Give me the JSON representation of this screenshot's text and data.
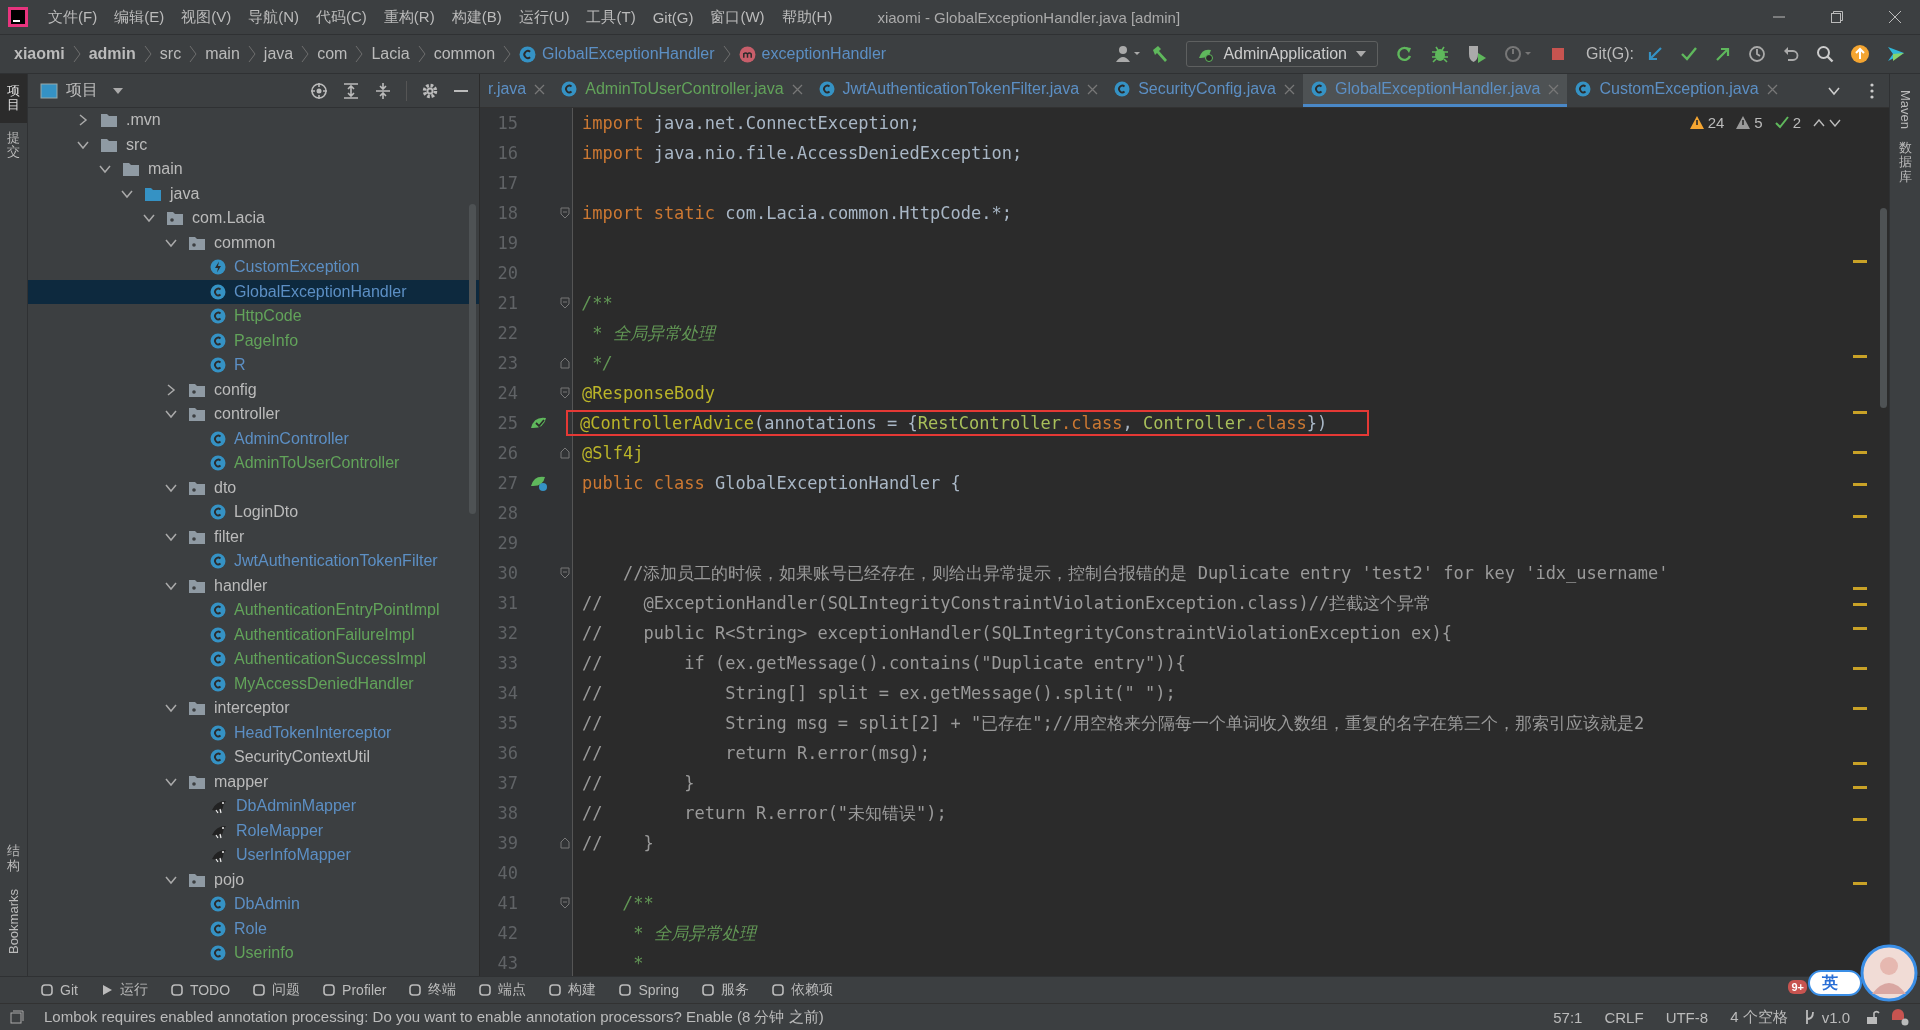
{
  "window": {
    "title": "xiaomi - GlobalExceptionHandler.java [admin]"
  },
  "menu": [
    "文件(F)",
    "编辑(E)",
    "视图(V)",
    "导航(N)",
    "代码(C)",
    "重构(R)",
    "构建(B)",
    "运行(U)",
    "工具(T)",
    "Git(G)",
    "窗口(W)",
    "帮助(H)"
  ],
  "breadcrumbs": [
    {
      "label": "xiaomi",
      "kind": "bold"
    },
    {
      "label": "admin",
      "kind": "bold"
    },
    {
      "label": "src",
      "kind": "plain"
    },
    {
      "label": "main",
      "kind": "plain"
    },
    {
      "label": "java",
      "kind": "plain"
    },
    {
      "label": "com",
      "kind": "plain"
    },
    {
      "label": "Lacia",
      "kind": "plain"
    },
    {
      "label": "common",
      "kind": "plain"
    },
    {
      "label": "GlobalExceptionHandler",
      "kind": "class"
    },
    {
      "label": "exceptionHandler",
      "kind": "method"
    }
  ],
  "toolbar": {
    "run_config": "AdminApplication",
    "git_label": "Git(G):"
  },
  "left_tool_strip": [
    {
      "label": "项目",
      "selected": true,
      "kind": "cjk"
    },
    {
      "label": "提交",
      "selected": false,
      "kind": "cjk"
    },
    {
      "label": "结构",
      "selected": false,
      "kind": "cjk"
    },
    {
      "label": "Bookmarks",
      "selected": false,
      "kind": "latin"
    }
  ],
  "project_panel": {
    "title": "项目"
  },
  "tree": {
    "items": [
      {
        "label": ".mvn",
        "kind": "folder",
        "expanded": false,
        "selected": false,
        "color": "#bbbbbb"
      },
      {
        "label": "src",
        "kind": "folder",
        "expanded": true,
        "selected": false,
        "color": "#bbbbbb",
        "children": [
          {
            "label": "main",
            "kind": "folder",
            "expanded": true,
            "selected": false,
            "color": "#bbbbbb",
            "children": [
              {
                "label": "java",
                "kind": "source",
                "expanded": true,
                "selected": false,
                "color": "#bbbbbb",
                "children": [
                  {
                    "label": "com.Lacia",
                    "kind": "package",
                    "expanded": true,
                    "selected": false,
                    "color": "#bbbbbb",
                    "children": [
                      {
                        "label": "common",
                        "kind": "package",
                        "expanded": true,
                        "selected": false,
                        "color": "#bbbbbb",
                        "children": [
                          {
                            "label": "CustomException",
                            "kind": "exception",
                            "selected": false,
                            "color": "#5c8fc4"
                          },
                          {
                            "label": "GlobalExceptionHandler",
                            "kind": "class",
                            "selected": true,
                            "color": "#5c8fc4"
                          },
                          {
                            "label": "HttpCode",
                            "kind": "class",
                            "selected": false,
                            "color": "#62a35a"
                          },
                          {
                            "label": "PageInfo",
                            "kind": "class",
                            "selected": false,
                            "color": "#62a35a"
                          },
                          {
                            "label": "R",
                            "kind": "class",
                            "selected": false,
                            "color": "#5c8fc4"
                          }
                        ]
                      },
                      {
                        "label": "config",
                        "kind": "package",
                        "expanded": false,
                        "selected": false,
                        "color": "#bbbbbb"
                      },
                      {
                        "label": "controller",
                        "kind": "package",
                        "expanded": true,
                        "selected": false,
                        "color": "#bbbbbb",
                        "children": [
                          {
                            "label": "AdminController",
                            "kind": "class",
                            "selected": false,
                            "color": "#5c8fc4"
                          },
                          {
                            "label": "AdminToUserController",
                            "kind": "class",
                            "selected": false,
                            "color": "#62a35a"
                          }
                        ]
                      },
                      {
                        "label": "dto",
                        "kind": "package",
                        "expanded": true,
                        "selected": false,
                        "color": "#bbbbbb",
                        "children": [
                          {
                            "label": "LoginDto",
                            "kind": "class",
                            "selected": false,
                            "color": "#bbbbbb"
                          }
                        ]
                      },
                      {
                        "label": "filter",
                        "kind": "package",
                        "expanded": true,
                        "selected": false,
                        "color": "#bbbbbb",
                        "children": [
                          {
                            "label": "JwtAuthenticationTokenFilter",
                            "kind": "class",
                            "selected": false,
                            "color": "#5c8fc4"
                          }
                        ]
                      },
                      {
                        "label": "handler",
                        "kind": "package",
                        "expanded": true,
                        "selected": false,
                        "color": "#bbbbbb",
                        "children": [
                          {
                            "label": "AuthenticationEntryPointImpl",
                            "kind": "class",
                            "selected": false,
                            "color": "#62a35a"
                          },
                          {
                            "label": "AuthenticationFailureImpl",
                            "kind": "class",
                            "selected": false,
                            "color": "#62a35a"
                          },
                          {
                            "label": "AuthenticationSuccessImpl",
                            "kind": "class",
                            "selected": false,
                            "color": "#62a35a"
                          },
                          {
                            "label": "MyAccessDeniedHandler",
                            "kind": "class",
                            "selected": false,
                            "color": "#62a35a"
                          }
                        ]
                      },
                      {
                        "label": "interceptor",
                        "kind": "package",
                        "expanded": true,
                        "selected": false,
                        "color": "#bbbbbb",
                        "children": [
                          {
                            "label": "HeadTokenInterceptor",
                            "kind": "class",
                            "selected": false,
                            "color": "#5c8fc4"
                          },
                          {
                            "label": "SecurityContextUtil",
                            "kind": "class",
                            "selected": false,
                            "color": "#bbbbbb"
                          }
                        ]
                      },
                      {
                        "label": "mapper",
                        "kind": "package",
                        "expanded": true,
                        "selected": false,
                        "color": "#bbbbbb",
                        "children": [
                          {
                            "label": "DbAdminMapper",
                            "kind": "mapper",
                            "selected": false,
                            "color": "#5c8fc4"
                          },
                          {
                            "label": "RoleMapper",
                            "kind": "mapper",
                            "selected": false,
                            "color": "#5c8fc4"
                          },
                          {
                            "label": "UserInfoMapper",
                            "kind": "mapper",
                            "selected": false,
                            "color": "#5c8fc4"
                          }
                        ]
                      },
                      {
                        "label": "pojo",
                        "kind": "package",
                        "expanded": true,
                        "selected": false,
                        "color": "#bbbbbb",
                        "children": [
                          {
                            "label": "DbAdmin",
                            "kind": "class",
                            "selected": false,
                            "color": "#5c8fc4"
                          },
                          {
                            "label": "Role",
                            "kind": "class",
                            "selected": false,
                            "color": "#5c8fc4"
                          },
                          {
                            "label": "Userinfo",
                            "kind": "class",
                            "selected": false,
                            "color": "#62a35a"
                          }
                        ]
                      }
                    ]
                  }
                ]
              }
            ]
          }
        ]
      }
    ]
  },
  "tabs": [
    {
      "label": "r.java",
      "kind": "clipped",
      "selected": false,
      "color": "#5c8fc4"
    },
    {
      "label": "AdminToUserController.java",
      "kind": "file",
      "selected": false,
      "color": "#62a35a"
    },
    {
      "label": "JwtAuthenticationTokenFilter.java",
      "kind": "file",
      "selected": false,
      "color": "#5c8fc4"
    },
    {
      "label": "SecurityConfig.java",
      "kind": "file",
      "selected": false,
      "color": "#5c8fc4"
    },
    {
      "label": "GlobalExceptionHandler.java",
      "kind": "file",
      "selected": true,
      "color": "#5c8fc4"
    },
    {
      "label": "CustomException.java",
      "kind": "file",
      "selected": false,
      "color": "#5c8fc4"
    }
  ],
  "inspections": {
    "warnings": "24",
    "weak_warnings": "5",
    "typos": "2"
  },
  "code": [
    {
      "number": "15",
      "tokens": [
        {
          "kind": "kw",
          "text": "import"
        },
        {
          "kind": "plain",
          "text": " java.net.ConnectException;"
        }
      ]
    },
    {
      "number": "16",
      "tokens": [
        {
          "kind": "kw",
          "text": "import"
        },
        {
          "kind": "plain",
          "text": " java.nio.file.AccessDeniedException;"
        }
      ]
    },
    {
      "number": "17"
    },
    {
      "number": "18",
      "fold": {
        "kind": "start"
      },
      "tokens": [
        {
          "kind": "kw",
          "text": "import static"
        },
        {
          "kind": "plain",
          "text": " com.Lacia.common.HttpCode.*;"
        }
      ]
    },
    {
      "number": "19"
    },
    {
      "number": "20"
    },
    {
      "number": "21",
      "fold": {
        "kind": "start"
      },
      "tokens": [
        {
          "kind": "doc",
          "text": "/**"
        }
      ]
    },
    {
      "number": "22",
      "tokens": [
        {
          "kind": "doc",
          "text": " * 全局异常处理"
        }
      ]
    },
    {
      "number": "23",
      "fold": {
        "kind": "end"
      },
      "tokens": [
        {
          "kind": "doc",
          "text": " */"
        }
      ]
    },
    {
      "number": "24",
      "fold": {
        "kind": "start"
      },
      "tokens": [
        {
          "kind": "ann",
          "text": "@ResponseBody"
        }
      ]
    },
    {
      "number": "25",
      "boxed": true,
      "gutter": {
        "kind": "bean-check"
      },
      "tokens": [
        {
          "kind": "ann",
          "text": "@ControllerAdvice"
        },
        {
          "kind": "plain",
          "text": "(annotations = {"
        },
        {
          "kind": "cls",
          "text": "RestController"
        },
        {
          "kind": "kw",
          "text": ".class"
        },
        {
          "kind": "plain",
          "text": ", "
        },
        {
          "kind": "cls",
          "text": "Controller"
        },
        {
          "kind": "kw",
          "text": ".class"
        },
        {
          "kind": "plain",
          "text": "})"
        }
      ]
    },
    {
      "number": "26",
      "fold": {
        "kind": "end"
      },
      "tokens": [
        {
          "kind": "ann",
          "text": "@Slf4j"
        }
      ]
    },
    {
      "number": "27",
      "gutter": {
        "kind": "bean"
      },
      "tokens": [
        {
          "kind": "kw",
          "text": "public class"
        },
        {
          "kind": "plain",
          "text": " GlobalExceptionHandler {"
        }
      ]
    },
    {
      "number": "28"
    },
    {
      "number": "29"
    },
    {
      "number": "30",
      "fold": {
        "kind": "start"
      },
      "tokens": [
        {
          "kind": "cmt",
          "text": "    //添加员工的时候，如果账号已经存在，则给出异常提示，控制台报错的是 Duplicate entry 'test2' for key 'idx_username'"
        }
      ]
    },
    {
      "number": "31",
      "tokens": [
        {
          "kind": "cmt",
          "text": "//    @ExceptionHandler(SQLIntegrityConstraintViolationException.class)//拦截这个异常"
        }
      ]
    },
    {
      "number": "32",
      "tokens": [
        {
          "kind": "cmt",
          "text": "//    public R<String> exceptionHandler(SQLIntegrityConstraintViolationException ex){"
        }
      ]
    },
    {
      "number": "33",
      "tokens": [
        {
          "kind": "cmt",
          "text": "//        if (ex.getMessage().contains(\"Duplicate entry\")){"
        }
      ]
    },
    {
      "number": "34",
      "tokens": [
        {
          "kind": "cmt",
          "text": "//            String[] split = ex.getMessage().split(\" \");"
        }
      ]
    },
    {
      "number": "35",
      "tokens": [
        {
          "kind": "cmt",
          "text": "//            String msg = split[2] + \"已存在\";//用空格来分隔每一个单词收入数组，重复的名字在第三个，那索引应该就是2"
        }
      ]
    },
    {
      "number": "36",
      "tokens": [
        {
          "kind": "cmt",
          "text": "//            return R.error(msg);"
        }
      ]
    },
    {
      "number": "37",
      "tokens": [
        {
          "kind": "cmt",
          "text": "//        }"
        }
      ]
    },
    {
      "number": "38",
      "tokens": [
        {
          "kind": "cmt",
          "text": "//        return R.error(\"未知错误\");"
        }
      ]
    },
    {
      "number": "39",
      "fold": {
        "kind": "end"
      },
      "tokens": [
        {
          "kind": "cmt",
          "text": "//    }"
        }
      ]
    },
    {
      "number": "40"
    },
    {
      "number": "41",
      "fold": {
        "kind": "start"
      },
      "tokens": [
        {
          "kind": "doc",
          "text": "    /**"
        }
      ]
    },
    {
      "number": "42",
      "tokens": [
        {
          "kind": "doc",
          "text": "     * 全局异常处理"
        }
      ]
    },
    {
      "number": "43",
      "tokens": [
        {
          "kind": "doc",
          "text": "     *"
        }
      ]
    }
  ],
  "right_tool_strip": [
    {
      "label": "Maven",
      "kind": "latin"
    },
    {
      "label": "数据库",
      "kind": "cjk"
    }
  ],
  "tool_windows": [
    "Git",
    "运行",
    "TODO",
    "问题",
    "Profiler",
    "终端",
    "端点",
    "构建",
    "Spring",
    "服务",
    "依赖项"
  ],
  "overlay": {
    "ime_label": "英",
    "badge": "9+"
  },
  "status_bar": {
    "message": "Lombok requires enabled annotation processing: Do you want to enable annotation processors? Enable (8 分钟 之前)",
    "position": "57:1",
    "line_separator": "CRLF",
    "encoding": "UTF-8",
    "indent": "4 个空格",
    "branch": "v1.0"
  }
}
